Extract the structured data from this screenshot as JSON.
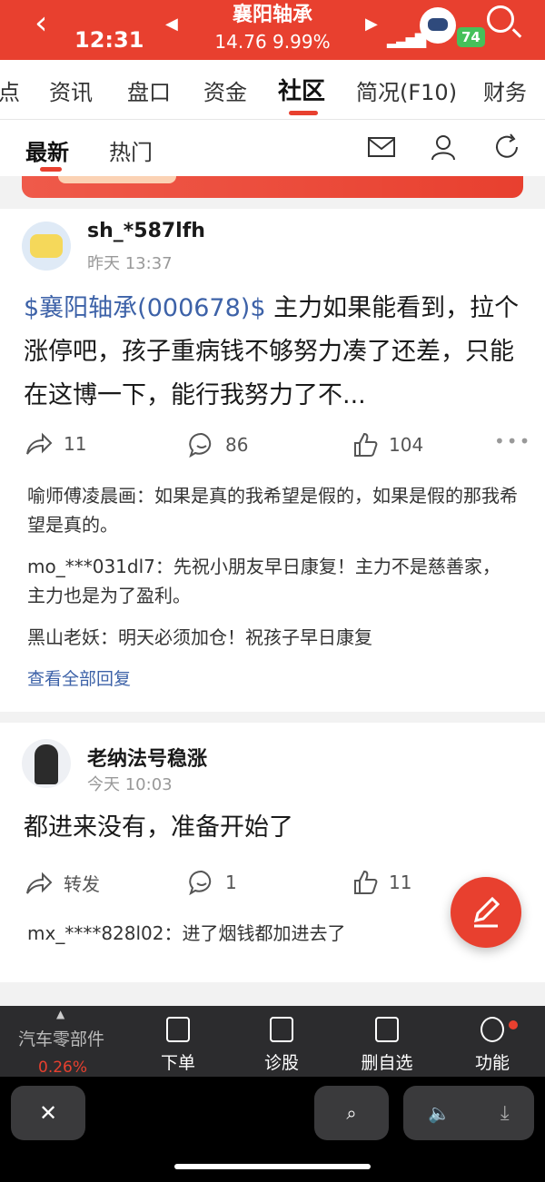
{
  "status": {
    "time": "12:31",
    "stock_name": "襄阳轴承",
    "price_line": "14.76 9.99%",
    "battery": "74"
  },
  "tabs": [
    "点",
    "资讯",
    "盘口",
    "资金",
    "社区",
    "简况(F10)",
    "财务"
  ],
  "active_tab": "社区",
  "subtabs": {
    "latest": "最新",
    "hot": "热门"
  },
  "posts": [
    {
      "user": "sh_*587lfh",
      "time": "昨天 13:37",
      "tag": "$襄阳轴承(000678)$",
      "text": " 主力如果能看到，拉个涨停吧，孩子重病钱不够努力凑了还差，只能在这博一下，能行我努力了不...",
      "shares": "11",
      "comments": "86",
      "likes": "104",
      "replies": [
        "喻师傅凌晨画：如果是真的我希望是假的，如果是假的那我希望是真的。",
        "mo_***031dl7：先祝小朋友早日康复！主力不是慈善家，主力也是为了盈利。",
        "黑山老妖：明天必须加仓！祝孩子早日康复"
      ],
      "view_all": "查看全部回复"
    },
    {
      "user": "老纳法号稳涨",
      "time": "今天 10:03",
      "text": "都进来没有，准备开始了",
      "shares": "转发",
      "comments": "1",
      "likes": "11",
      "replies": [
        "mx_****828l02：进了烟钱都加进去了"
      ]
    }
  ],
  "bottom": {
    "sector": "汽车零部件",
    "sector_pct": "0.26%",
    "items": [
      "下单",
      "诊股",
      "删自选",
      "功能"
    ]
  },
  "colors": {
    "accent": "#e8402f",
    "link": "#3d62a8"
  }
}
